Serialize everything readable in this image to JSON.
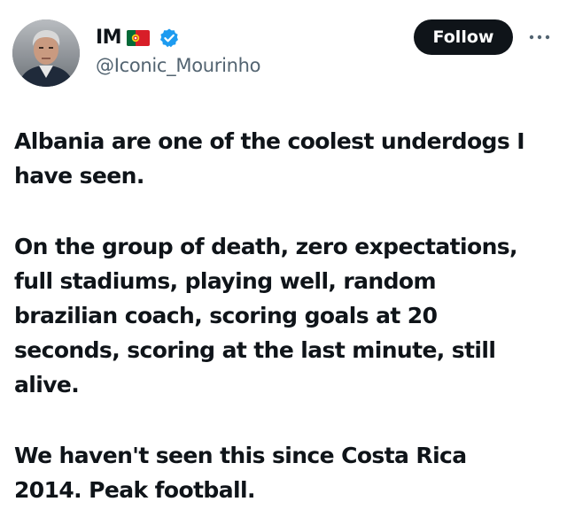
{
  "tweet": {
    "author": {
      "display_name": "IM",
      "flag": "portugal-flag",
      "verified": true,
      "handle": "@Iconic_Mourinho",
      "avatar": "profile-photo"
    },
    "follow_label": "Follow",
    "more_icon": "more-icon",
    "paragraphs": [
      {
        "lines": [
          "Albania are one of the coolest underdogs I",
          "have seen."
        ]
      },
      {
        "lines": [
          "On the group of death, zero expectations,",
          "full stadiums, playing well, random",
          "brazilian coach, scoring goals at 20",
          "seconds, scoring at the last minute, still",
          "alive."
        ]
      },
      {
        "lines": [
          "We haven't seen this since Costa Rica",
          "2014. Peak football."
        ]
      }
    ]
  },
  "colors": {
    "text": "#0f1419",
    "secondary": "#536471",
    "verified": "#1d9bf0",
    "button_bg": "#0f1419",
    "button_text": "#ffffff"
  }
}
